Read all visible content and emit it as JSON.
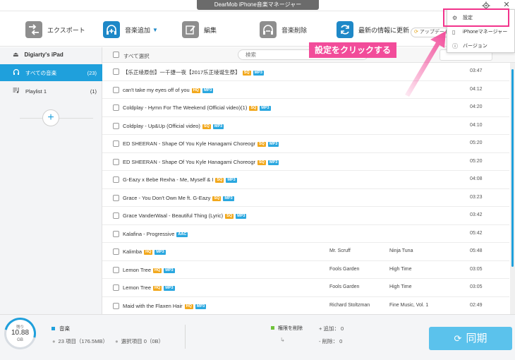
{
  "window": {
    "title": "DearMob iPhone音楽マネージャー"
  },
  "toolbar": {
    "export_label": "エクスポート",
    "add_label": "音楽追加",
    "edit_label": "編集",
    "delete_label": "音楽削除",
    "refresh_label": "最新の情報に更新",
    "update_label": "アップデート"
  },
  "menu": {
    "settings_label": "設定",
    "manager_label": "iPhoneマネージャー",
    "version_label": "バージョン"
  },
  "annotation": {
    "text": "設定をクリックする"
  },
  "sidebar": {
    "device_name": "Digiarty's iPad",
    "items": [
      {
        "label": "すべての音楽",
        "count": "(23)"
      },
      {
        "label": "Playlist 1",
        "count": "(1)"
      }
    ]
  },
  "list": {
    "select_all_label": "すべて選択",
    "search_placeholder": "検索",
    "rows": [
      {
        "title": "【乐正绫原创】一千捷一夜【2017乐正绫诞生祭】",
        "badges": [
          "SQ",
          "MP3"
        ],
        "artist": "",
        "album": "",
        "duration": "03:47"
      },
      {
        "title": "can't take my eyes off of you",
        "badges": [
          "HQ",
          "MP3"
        ],
        "artist": "",
        "album": "",
        "duration": "04:12"
      },
      {
        "title": "Coldplay - Hymn For The Weekend (Official video)(1)",
        "badges": [
          "SQ",
          "MP3"
        ],
        "artist": "",
        "album": "",
        "duration": "04:20"
      },
      {
        "title": "Coldplay - Up&Up (Official video)",
        "badges": [
          "SQ",
          "MP3"
        ],
        "artist": "",
        "album": "",
        "duration": "04:10"
      },
      {
        "title": "ED SHEERAN - Shape Of You   Kyle Hanagami Choreogr",
        "badges": [
          "SQ",
          "MP3"
        ],
        "artist": "",
        "album": "",
        "duration": "05:20"
      },
      {
        "title": "ED SHEERAN - Shape Of You   Kyle Hanagami Choreogr",
        "badges": [
          "SQ",
          "MP3"
        ],
        "artist": "",
        "album": "",
        "duration": "05:20"
      },
      {
        "title": "G-Eazy x Bebe Rexha - Me, Myself & I",
        "badges": [
          "SQ",
          "MP3"
        ],
        "artist": "",
        "album": "",
        "duration": "04:08"
      },
      {
        "title": "Grace - You Don't Own Me ft. G-Eazy",
        "badges": [
          "SQ",
          "MP3"
        ],
        "artist": "",
        "album": "",
        "duration": "03:23"
      },
      {
        "title": "Grace VanderWaal - Beautiful Thing (Lyric)",
        "badges": [
          "SQ",
          "MP3"
        ],
        "artist": "",
        "album": "",
        "duration": "03:42"
      },
      {
        "title": "Kalafina - Progressive",
        "badges": [
          "AAC"
        ],
        "artist": "",
        "album": "",
        "duration": "05:42"
      },
      {
        "title": "Kalimba",
        "badges": [
          "HQ",
          "MP3"
        ],
        "artist": "Mr. Scruff",
        "album": "Ninja Tuna",
        "duration": "05:48"
      },
      {
        "title": "Lemon Tree",
        "badges": [
          "HQ",
          "MP3"
        ],
        "artist": "Fools Garden",
        "album": "High Time",
        "duration": "03:05"
      },
      {
        "title": "Lemon Tree",
        "badges": [
          "HQ",
          "MP3"
        ],
        "artist": "Fools Garden",
        "album": "High Time",
        "duration": "03:05"
      },
      {
        "title": "Maid with the Flaxen Hair",
        "badges": [
          "HQ",
          "MP3"
        ],
        "artist": "Richard Stoltzman",
        "album": "Fine Music, Vol. 1",
        "duration": "02:49"
      }
    ]
  },
  "status": {
    "remaining_label": "残り",
    "remaining_value": "10.88",
    "remaining_unit": "GB",
    "category_label": "音楽",
    "items_summary": "23 項目（176.5MB）",
    "selected_summary": "選択項目 0（0B）",
    "permission_label": "権限を削除",
    "add_summary": "+ 追加： 0",
    "delete_summary": "- 削除： 0",
    "sync_label": "同期"
  },
  "colors": {
    "accent": "#1fa0dc",
    "annotation": "#f24c9a",
    "sync": "#5bc2ec"
  }
}
